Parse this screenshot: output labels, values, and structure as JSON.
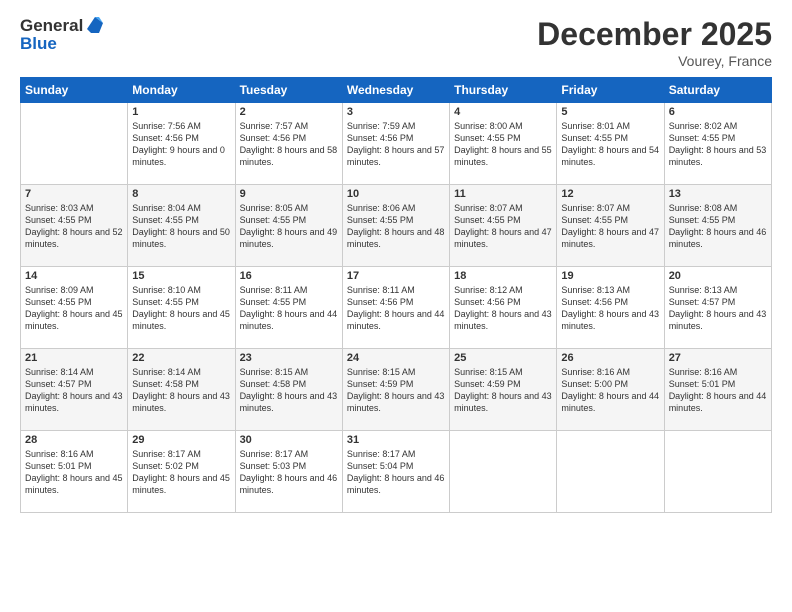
{
  "logo": {
    "general": "General",
    "blue": "Blue"
  },
  "title": "December 2025",
  "location": "Vourey, France",
  "days_header": [
    "Sunday",
    "Monday",
    "Tuesday",
    "Wednesday",
    "Thursday",
    "Friday",
    "Saturday"
  ],
  "weeks": [
    [
      {
        "day": "",
        "sunrise": "",
        "sunset": "",
        "daylight": ""
      },
      {
        "day": "1",
        "sunrise": "Sunrise: 7:56 AM",
        "sunset": "Sunset: 4:56 PM",
        "daylight": "Daylight: 9 hours and 0 minutes."
      },
      {
        "day": "2",
        "sunrise": "Sunrise: 7:57 AM",
        "sunset": "Sunset: 4:56 PM",
        "daylight": "Daylight: 8 hours and 58 minutes."
      },
      {
        "day": "3",
        "sunrise": "Sunrise: 7:59 AM",
        "sunset": "Sunset: 4:56 PM",
        "daylight": "Daylight: 8 hours and 57 minutes."
      },
      {
        "day": "4",
        "sunrise": "Sunrise: 8:00 AM",
        "sunset": "Sunset: 4:55 PM",
        "daylight": "Daylight: 8 hours and 55 minutes."
      },
      {
        "day": "5",
        "sunrise": "Sunrise: 8:01 AM",
        "sunset": "Sunset: 4:55 PM",
        "daylight": "Daylight: 8 hours and 54 minutes."
      },
      {
        "day": "6",
        "sunrise": "Sunrise: 8:02 AM",
        "sunset": "Sunset: 4:55 PM",
        "daylight": "Daylight: 8 hours and 53 minutes."
      }
    ],
    [
      {
        "day": "7",
        "sunrise": "Sunrise: 8:03 AM",
        "sunset": "Sunset: 4:55 PM",
        "daylight": "Daylight: 8 hours and 52 minutes."
      },
      {
        "day": "8",
        "sunrise": "Sunrise: 8:04 AM",
        "sunset": "Sunset: 4:55 PM",
        "daylight": "Daylight: 8 hours and 50 minutes."
      },
      {
        "day": "9",
        "sunrise": "Sunrise: 8:05 AM",
        "sunset": "Sunset: 4:55 PM",
        "daylight": "Daylight: 8 hours and 49 minutes."
      },
      {
        "day": "10",
        "sunrise": "Sunrise: 8:06 AM",
        "sunset": "Sunset: 4:55 PM",
        "daylight": "Daylight: 8 hours and 48 minutes."
      },
      {
        "day": "11",
        "sunrise": "Sunrise: 8:07 AM",
        "sunset": "Sunset: 4:55 PM",
        "daylight": "Daylight: 8 hours and 47 minutes."
      },
      {
        "day": "12",
        "sunrise": "Sunrise: 8:07 AM",
        "sunset": "Sunset: 4:55 PM",
        "daylight": "Daylight: 8 hours and 47 minutes."
      },
      {
        "day": "13",
        "sunrise": "Sunrise: 8:08 AM",
        "sunset": "Sunset: 4:55 PM",
        "daylight": "Daylight: 8 hours and 46 minutes."
      }
    ],
    [
      {
        "day": "14",
        "sunrise": "Sunrise: 8:09 AM",
        "sunset": "Sunset: 4:55 PM",
        "daylight": "Daylight: 8 hours and 45 minutes."
      },
      {
        "day": "15",
        "sunrise": "Sunrise: 8:10 AM",
        "sunset": "Sunset: 4:55 PM",
        "daylight": "Daylight: 8 hours and 45 minutes."
      },
      {
        "day": "16",
        "sunrise": "Sunrise: 8:11 AM",
        "sunset": "Sunset: 4:55 PM",
        "daylight": "Daylight: 8 hours and 44 minutes."
      },
      {
        "day": "17",
        "sunrise": "Sunrise: 8:11 AM",
        "sunset": "Sunset: 4:56 PM",
        "daylight": "Daylight: 8 hours and 44 minutes."
      },
      {
        "day": "18",
        "sunrise": "Sunrise: 8:12 AM",
        "sunset": "Sunset: 4:56 PM",
        "daylight": "Daylight: 8 hours and 43 minutes."
      },
      {
        "day": "19",
        "sunrise": "Sunrise: 8:13 AM",
        "sunset": "Sunset: 4:56 PM",
        "daylight": "Daylight: 8 hours and 43 minutes."
      },
      {
        "day": "20",
        "sunrise": "Sunrise: 8:13 AM",
        "sunset": "Sunset: 4:57 PM",
        "daylight": "Daylight: 8 hours and 43 minutes."
      }
    ],
    [
      {
        "day": "21",
        "sunrise": "Sunrise: 8:14 AM",
        "sunset": "Sunset: 4:57 PM",
        "daylight": "Daylight: 8 hours and 43 minutes."
      },
      {
        "day": "22",
        "sunrise": "Sunrise: 8:14 AM",
        "sunset": "Sunset: 4:58 PM",
        "daylight": "Daylight: 8 hours and 43 minutes."
      },
      {
        "day": "23",
        "sunrise": "Sunrise: 8:15 AM",
        "sunset": "Sunset: 4:58 PM",
        "daylight": "Daylight: 8 hours and 43 minutes."
      },
      {
        "day": "24",
        "sunrise": "Sunrise: 8:15 AM",
        "sunset": "Sunset: 4:59 PM",
        "daylight": "Daylight: 8 hours and 43 minutes."
      },
      {
        "day": "25",
        "sunrise": "Sunrise: 8:15 AM",
        "sunset": "Sunset: 4:59 PM",
        "daylight": "Daylight: 8 hours and 43 minutes."
      },
      {
        "day": "26",
        "sunrise": "Sunrise: 8:16 AM",
        "sunset": "Sunset: 5:00 PM",
        "daylight": "Daylight: 8 hours and 44 minutes."
      },
      {
        "day": "27",
        "sunrise": "Sunrise: 8:16 AM",
        "sunset": "Sunset: 5:01 PM",
        "daylight": "Daylight: 8 hours and 44 minutes."
      }
    ],
    [
      {
        "day": "28",
        "sunrise": "Sunrise: 8:16 AM",
        "sunset": "Sunset: 5:01 PM",
        "daylight": "Daylight: 8 hours and 45 minutes."
      },
      {
        "day": "29",
        "sunrise": "Sunrise: 8:17 AM",
        "sunset": "Sunset: 5:02 PM",
        "daylight": "Daylight: 8 hours and 45 minutes."
      },
      {
        "day": "30",
        "sunrise": "Sunrise: 8:17 AM",
        "sunset": "Sunset: 5:03 PM",
        "daylight": "Daylight: 8 hours and 46 minutes."
      },
      {
        "day": "31",
        "sunrise": "Sunrise: 8:17 AM",
        "sunset": "Sunset: 5:04 PM",
        "daylight": "Daylight: 8 hours and 46 minutes."
      },
      {
        "day": "",
        "sunrise": "",
        "sunset": "",
        "daylight": ""
      },
      {
        "day": "",
        "sunrise": "",
        "sunset": "",
        "daylight": ""
      },
      {
        "day": "",
        "sunrise": "",
        "sunset": "",
        "daylight": ""
      }
    ]
  ]
}
